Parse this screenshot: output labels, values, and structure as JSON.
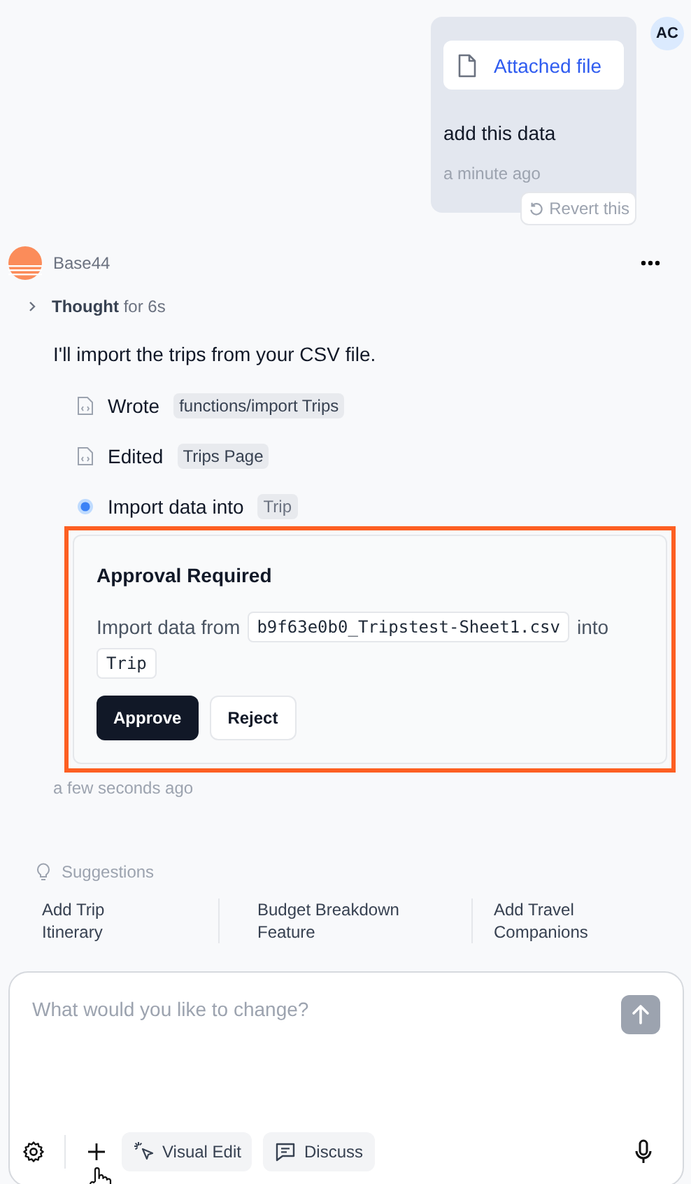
{
  "user_message": {
    "avatar": "AC",
    "attachment": "Attached file",
    "text": "add this data",
    "time": "a minute ago",
    "revert": "Revert this"
  },
  "assistant": {
    "name": "Base44",
    "thought": {
      "label": "Thought",
      "duration": "for 6s",
      "expanded": false
    },
    "text": "I'll import the trips from your CSV file.",
    "steps": [
      {
        "kind": "file",
        "verb": "Wrote",
        "target": "functions/import Trips"
      },
      {
        "kind": "file",
        "verb": "Edited",
        "target": "Trips Page"
      },
      {
        "kind": "pending",
        "verb": "Import data into",
        "target": "Trip"
      }
    ],
    "approval": {
      "highlighted": true,
      "title": "Approval Required",
      "prefix": "Import data from",
      "file": "b9f63e0b0_Tripstest-Sheet1.csv",
      "middle": "into",
      "entity": "Trip",
      "approve": "Approve",
      "reject": "Reject"
    },
    "time": "a few seconds ago"
  },
  "suggestions": {
    "label": "Suggestions",
    "items": [
      "Add Trip Itinerary",
      "Budget Breakdown Feature",
      "Add Travel Companions"
    ]
  },
  "composer": {
    "placeholder": "What would you like to change?",
    "buttons": [
      "Visual Edit",
      "Discuss"
    ]
  }
}
